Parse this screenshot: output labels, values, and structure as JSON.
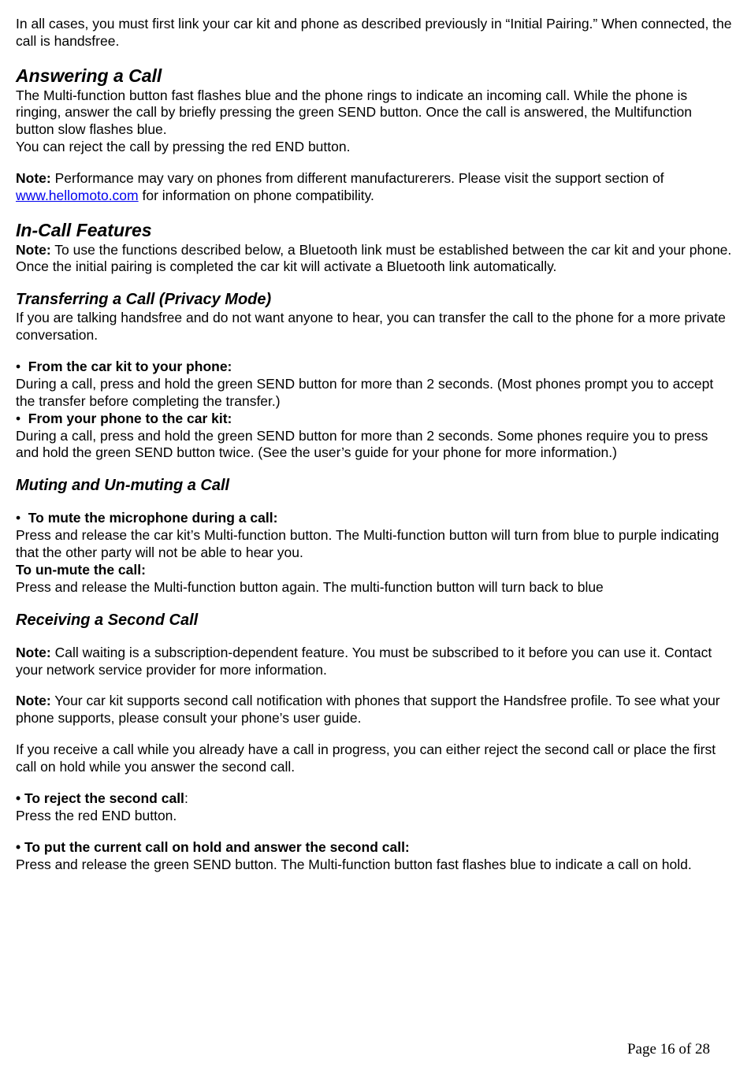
{
  "intro": "In all cases, you must first link your car kit and phone as described previously in “Initial Pairing.” When connected, the call is handsfree.",
  "answering": {
    "heading": "Answering a Call",
    "p1": "The Multi-function button fast flashes blue and the phone rings to indicate an incoming call. While the phone is ringing, answer the call by briefly pressing the green SEND button. Once the call is answered, the Multifunction button slow flashes blue.",
    "p2": "You can reject the call by pressing the red END button.",
    "note_label": "Note:",
    "note_a": " Performance may vary on phones from different manufacturerers. Please visit the support section of ",
    "note_link": "www.hellomoto.com",
    "note_b": " for information on phone compatibility."
  },
  "incall": {
    "heading": "In-Call Features",
    "note_label": "Note:",
    "note_text": " To use the functions described below, a Bluetooth link must be established between the car kit and your phone. Once the initial pairing is completed the car kit will activate a Bluetooth link automatically."
  },
  "transfer": {
    "heading": "Transferring a Call (Privacy Mode)",
    "p1": "If you are talking handsfree and do not want anyone to hear, you can transfer the call to the phone for a more private conversation.",
    "b1_label": "From the car kit to your phone:",
    "b1_text": "During a call, press and hold the green SEND button for more than 2 seconds. (Most phones prompt you to accept the transfer before completing the transfer.)",
    "b2_label": "From your phone to the car kit:",
    "b2_text": "During a call, press and hold the green SEND button for more than 2 seconds. Some phones require you to press and hold the green SEND button twice. (See the user’s guide for your phone for more information.)"
  },
  "muting": {
    "heading": "Muting and Un-muting a Call",
    "b1_label": "To mute the microphone during a call:",
    "b1_text": "Press and release the car kit’s Multi-function button. The Multi-function button will turn from blue to purple indicating that the other party will not be able to hear you.",
    "b2_label": "To un-mute the call:",
    "b2_text": "Press and release the Multi-function button again. The multi-function button will turn back to blue"
  },
  "second": {
    "heading": "Receiving a Second Call",
    "note1_label": "Note:",
    "note1_text": " Call waiting is a subscription-dependent feature. You must be subscribed to it before you can use it. Contact your network service provider for more information.",
    "note2_label": "Note:",
    "note2_text": " Your car kit supports second call notification with phones that support the Handsfree profile. To see what your phone supports, please consult your phone’s user guide.",
    "p3": "If you receive a call while you already have a call in progress, you can either reject the second call or place the first call on hold while you answer the second call.",
    "b1_label": "• To reject the second call",
    "b1_colon": ":",
    "b1_text": "Press the red END button.",
    "b2_label": "• To put the current call on hold and answer the second call:",
    "b2_text": "Press and release the green SEND button. The Multi-function button fast flashes blue to indicate a call on hold."
  },
  "footer": "Page 16 of 28"
}
